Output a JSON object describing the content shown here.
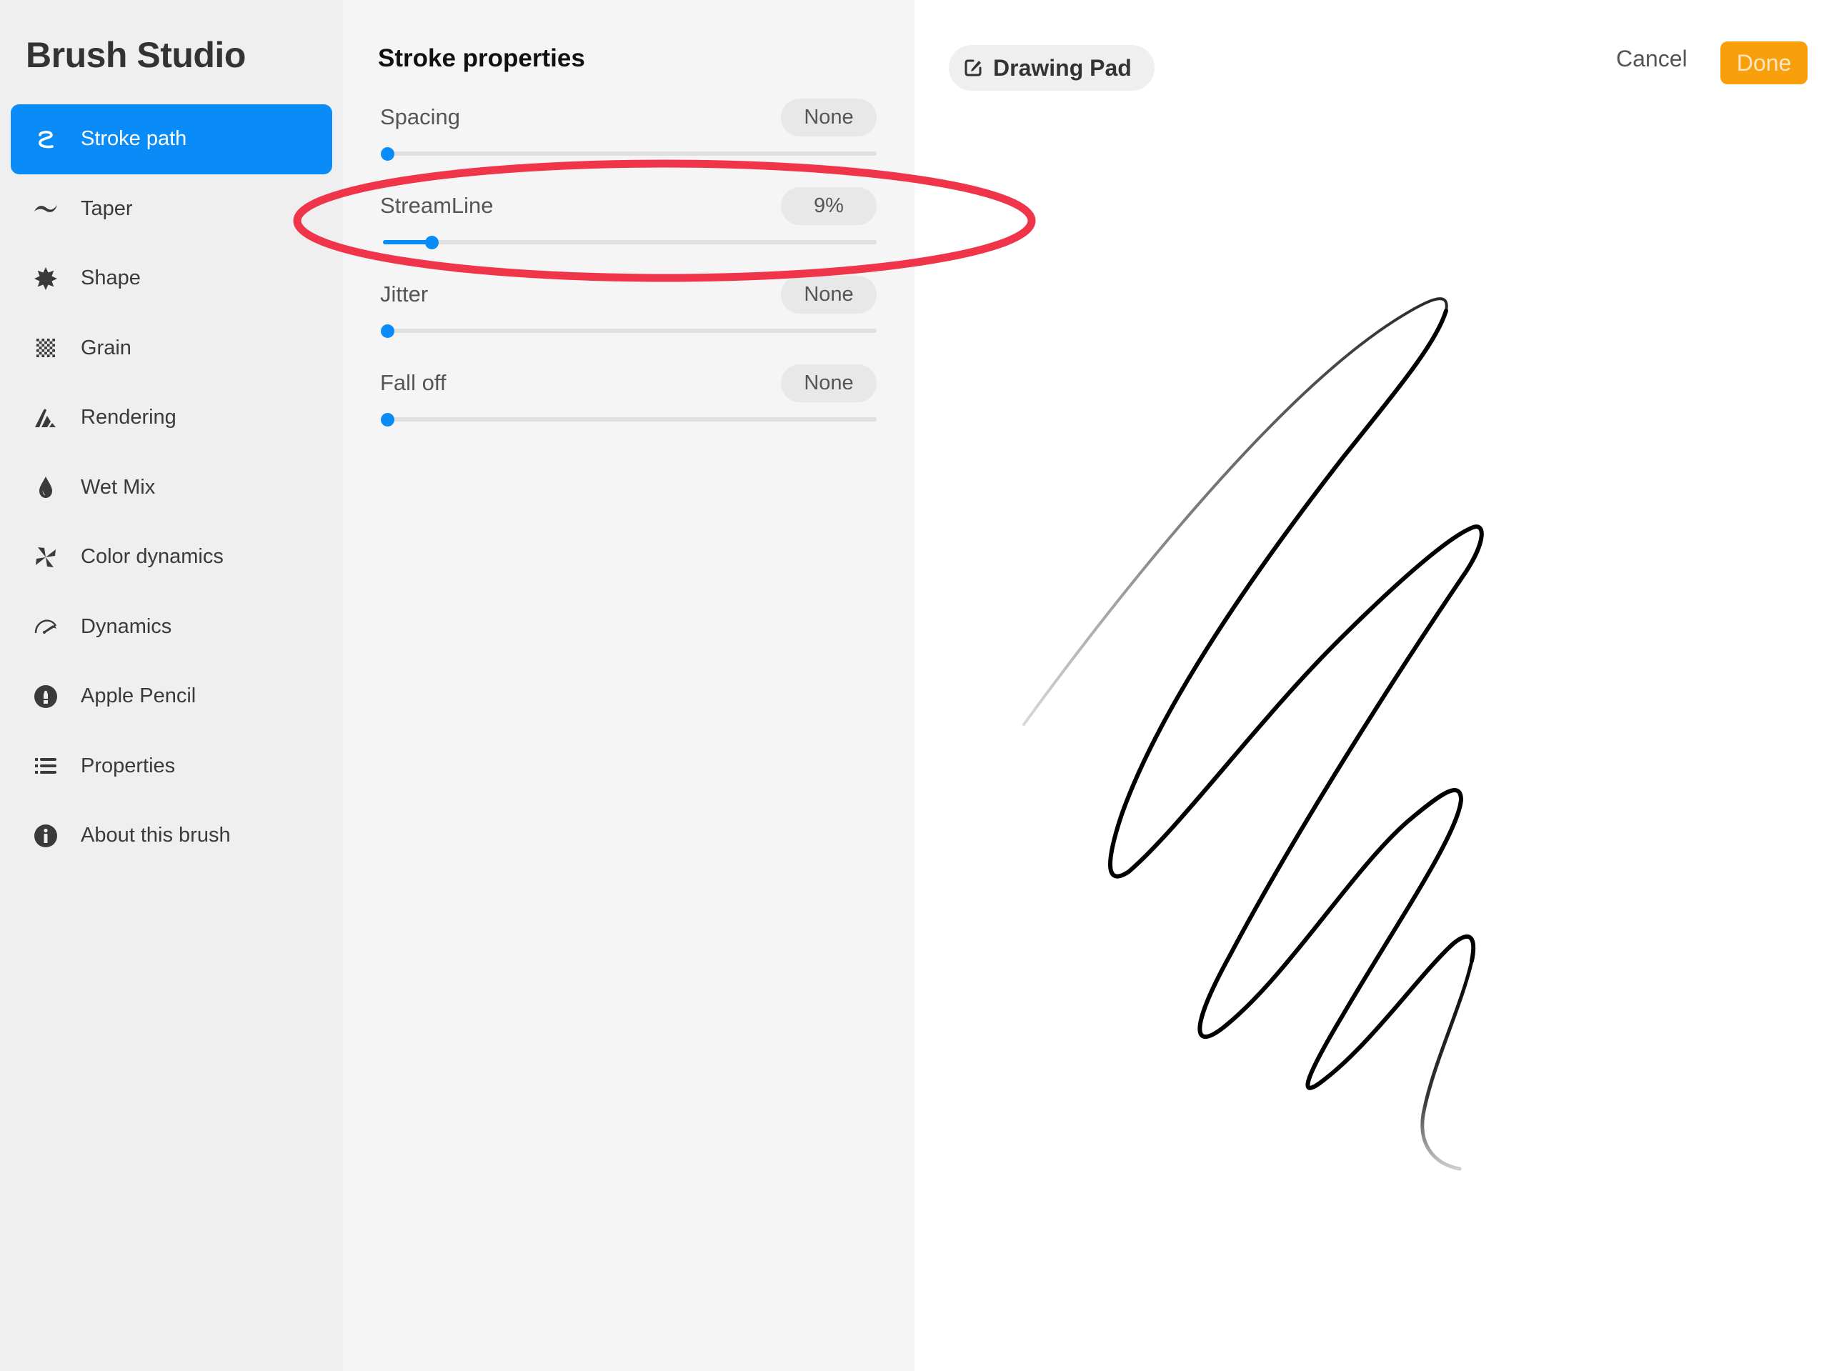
{
  "sidebar": {
    "title": "Brush Studio",
    "items": [
      {
        "label": "Stroke path",
        "icon": "stroke-path-icon",
        "active": true
      },
      {
        "label": "Taper",
        "icon": "taper-icon"
      },
      {
        "label": "Shape",
        "icon": "shape-icon"
      },
      {
        "label": "Grain",
        "icon": "grain-icon"
      },
      {
        "label": "Rendering",
        "icon": "rendering-icon"
      },
      {
        "label": "Wet Mix",
        "icon": "wet-mix-icon"
      },
      {
        "label": "Color dynamics",
        "icon": "color-dynamics-icon"
      },
      {
        "label": "Dynamics",
        "icon": "dynamics-icon"
      },
      {
        "label": "Apple Pencil",
        "icon": "apple-pencil-icon"
      },
      {
        "label": "Properties",
        "icon": "properties-icon"
      },
      {
        "label": "About this brush",
        "icon": "info-icon"
      }
    ]
  },
  "panel": {
    "title": "Stroke properties",
    "properties": [
      {
        "label": "Spacing",
        "value": "None",
        "fraction": 0.0
      },
      {
        "label": "StreamLine",
        "value": "9%",
        "fraction": 0.09
      },
      {
        "label": "Jitter",
        "value": "None",
        "fraction": 0.0
      },
      {
        "label": "Fall off",
        "value": "None",
        "fraction": 0.0
      }
    ]
  },
  "canvas": {
    "drawing_pad_label": "Drawing Pad",
    "drawing_pad_icon": "edit-icon",
    "cancel_label": "Cancel",
    "done_label": "Done"
  },
  "colors": {
    "accent": "#0a8cf8",
    "done": "#f99f0c",
    "annotation": "#f0344a"
  }
}
